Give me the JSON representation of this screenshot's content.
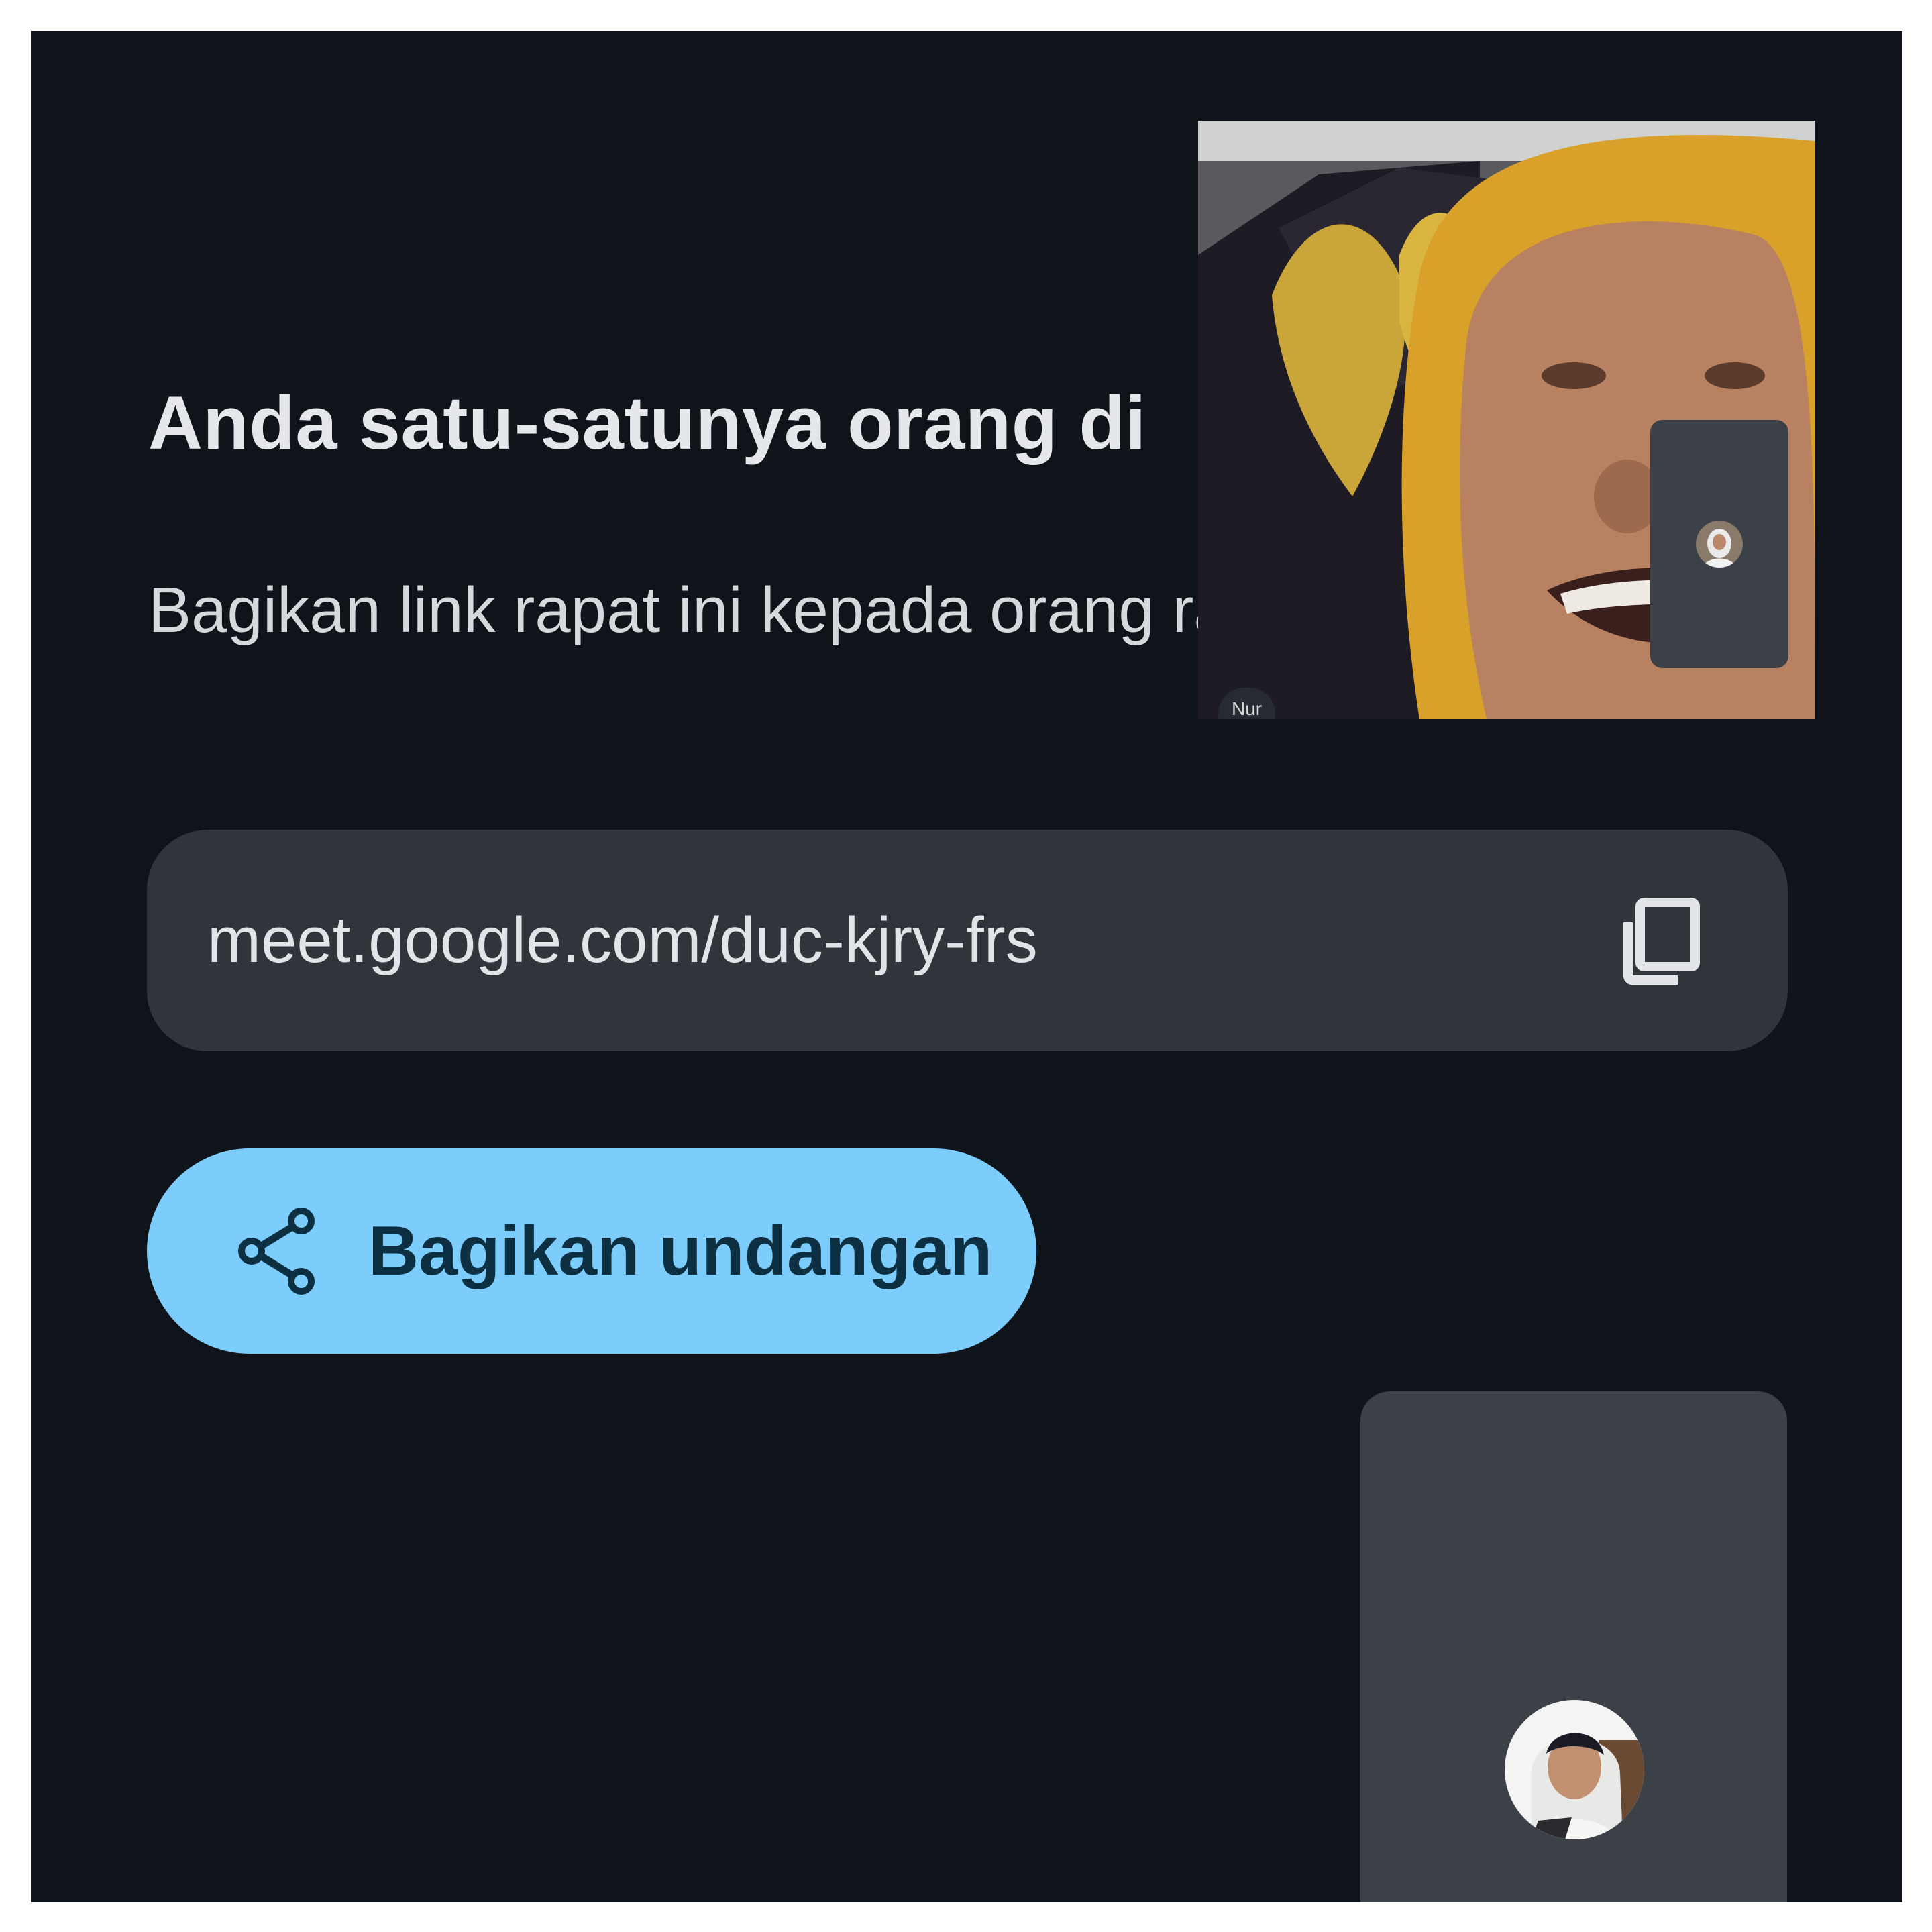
{
  "headline": "Anda satu-satunya orang di",
  "subtext": "Bagikan link rapat ini kepada orang rapat",
  "meeting_link": "meet.google.com/duc-kjry-frs",
  "share_button_label": "Bagikan undangan",
  "self_view": {
    "name_chip": "Nur"
  },
  "icons": {
    "copy": "copy-icon",
    "share": "share-icon"
  },
  "colors": {
    "background": "#0f131a",
    "link_box": "#30343b",
    "share_button": "#7ccdfc",
    "share_button_text": "#0d2f42",
    "tile": "#3c4047"
  }
}
